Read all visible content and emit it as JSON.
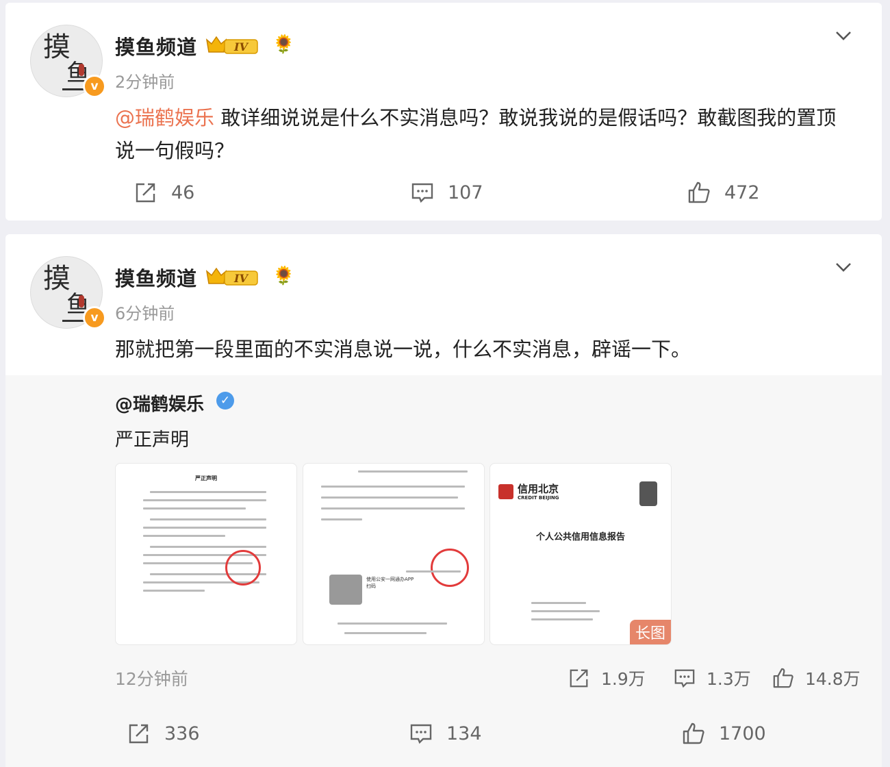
{
  "colors": {
    "accent": "#eb7350",
    "verified_orange": "#f79a1f",
    "verified_blue": "#4d9bea"
  },
  "post1": {
    "author": "摸鱼频道",
    "level_badge": "IV",
    "time": "2分钟前",
    "mention": "@瑞鹤娱乐",
    "text": " 敢详细说说是什么不实消息吗？敢说我说的是假话吗？敢截图我的置顶说一句假吗？",
    "reposts": "46",
    "comments": "107",
    "likes": "472"
  },
  "post2": {
    "author": "摸鱼频道",
    "level_badge": "IV",
    "time": "6分钟前",
    "text": "那就把第一段里面的不实消息说一说，什么不实消息，辟谣一下。",
    "repost": {
      "user": "@瑞鹤娱乐",
      "text": "严正声明",
      "images": [
        {
          "title": "严正声明"
        },
        {
          "caption": "使用公安一网通办APP扫码"
        },
        {
          "brand": "信用北京",
          "brand_en": "CREDIT BEIJING",
          "title": "个人公共信用信息报告",
          "tag": "长图"
        }
      ],
      "time": "12分钟前",
      "reposts": "1.9万",
      "comments": "1.3万",
      "likes": "14.8万"
    },
    "reposts": "336",
    "comments": "134",
    "likes": "1700"
  }
}
